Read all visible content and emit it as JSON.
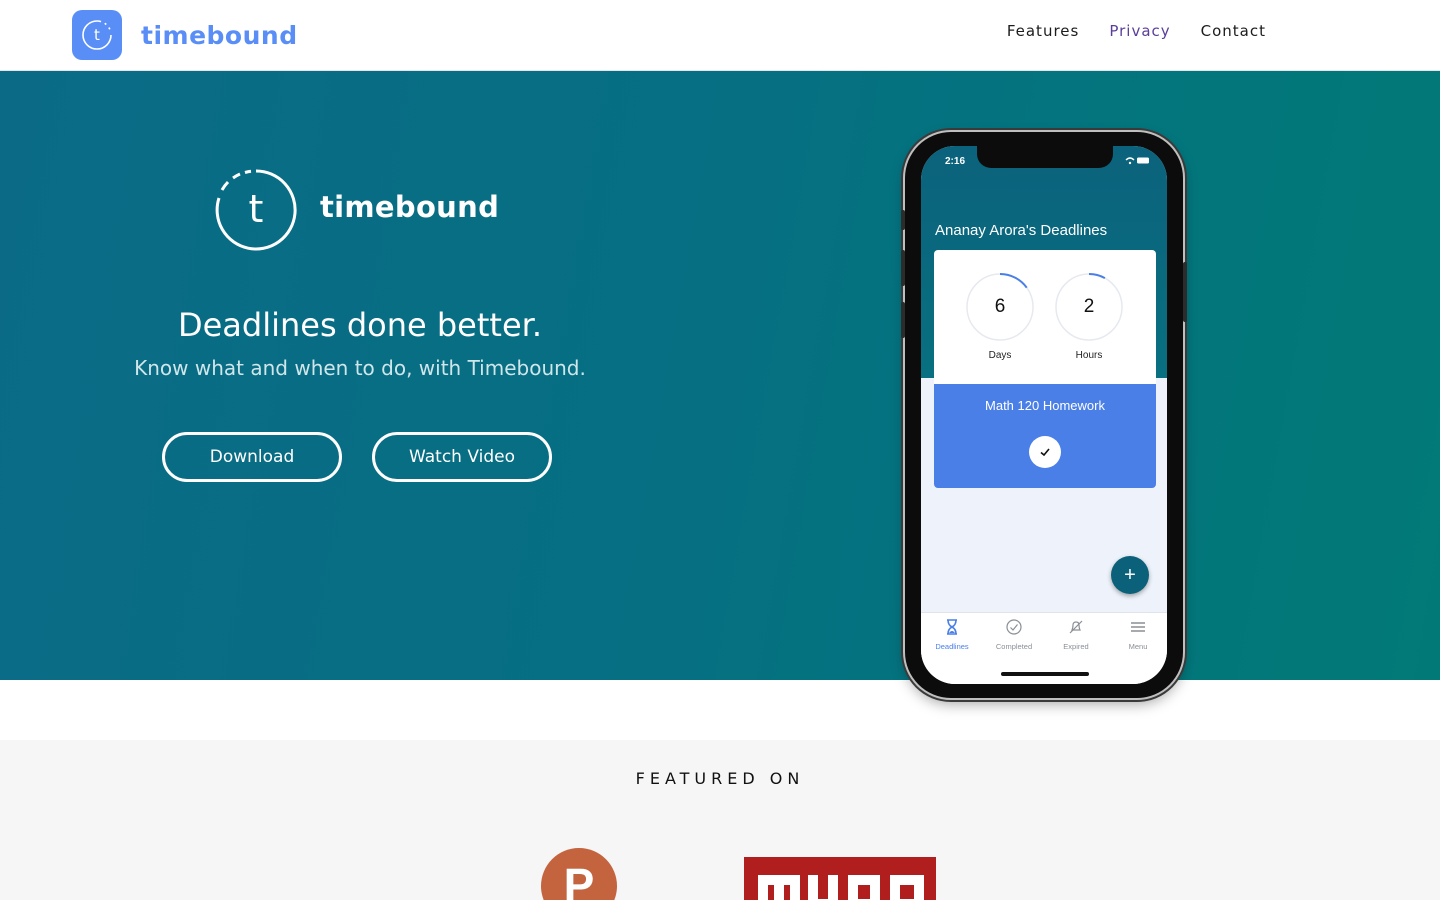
{
  "nav": {
    "brand_name": "timebound",
    "brand_icon": "t",
    "links": [
      "Features",
      "Privacy",
      "Contact"
    ],
    "active_link": "Privacy"
  },
  "hero": {
    "logo_letter": "t",
    "logo_name": "timebound",
    "headline": "Deadlines done better.",
    "subheadline": "Know what and when to do, with Timebound.",
    "buttons": {
      "download": "Download",
      "watch_video": "Watch Video"
    }
  },
  "phone": {
    "status_time": "2:16",
    "title": "Ananay Arora's Deadlines",
    "countdown": [
      {
        "value": "6",
        "label": "Days",
        "progress": 0.15
      },
      {
        "value": "2",
        "label": "Hours",
        "progress": 0.08
      }
    ],
    "task_name": "Math 120 Homework",
    "fab_label": "+",
    "tabs": [
      {
        "label": "Deadlines",
        "icon": "hourglass-icon",
        "active": true
      },
      {
        "label": "Completed",
        "icon": "check-circle-icon",
        "active": false
      },
      {
        "label": "Expired",
        "icon": "bell-off-icon",
        "active": false
      },
      {
        "label": "Menu",
        "icon": "menu-icon",
        "active": false
      }
    ]
  },
  "featured": {
    "title": "FEATURED ON",
    "logos": [
      {
        "name": "product-hunt",
        "letter": "P"
      },
      {
        "name": "muo",
        "text": "MUO"
      }
    ]
  },
  "colors": {
    "brand_blue": "#5a8ef7",
    "hero_start": "#0b6b86",
    "hero_end": "#017a77",
    "card_blue": "#4a7fe8",
    "nav_active": "#5b3d9a",
    "product_hunt": "#c4643f",
    "muo_red": "#b01e1e"
  }
}
